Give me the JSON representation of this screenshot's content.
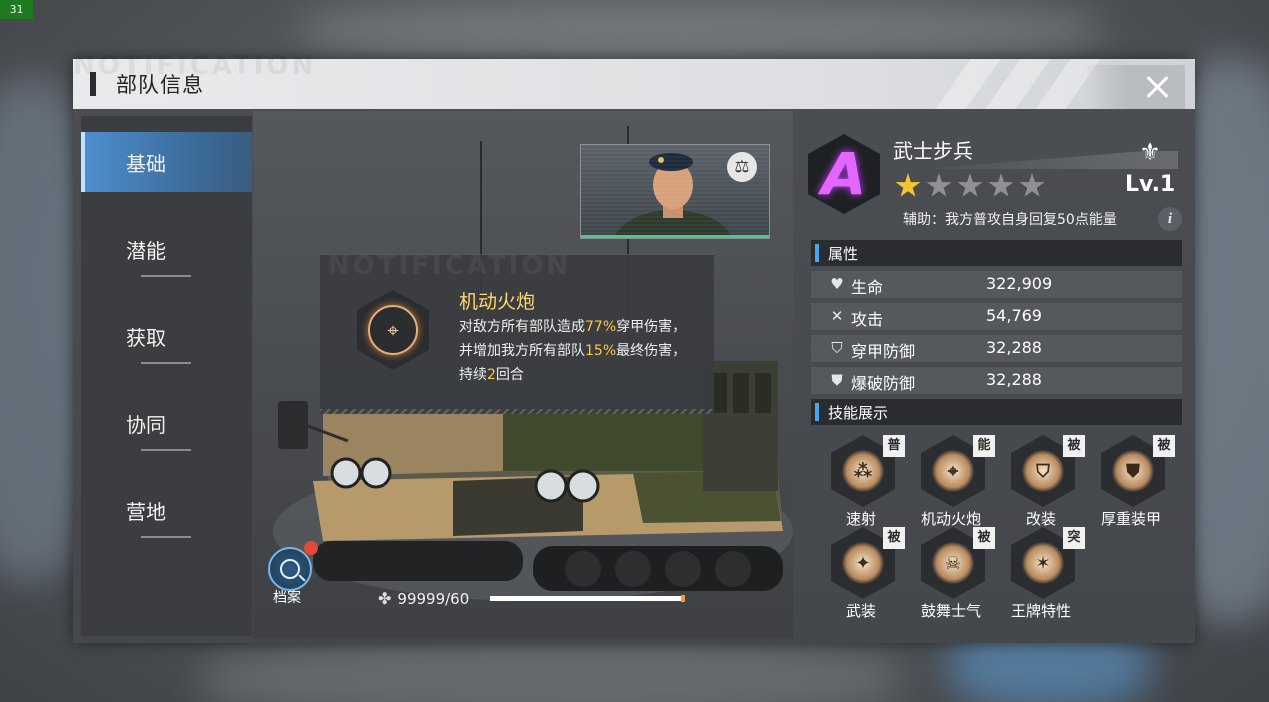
{
  "fps": "31",
  "window": {
    "title": "部队信息",
    "watermark": "NOTIFICATION"
  },
  "nav": [
    {
      "label": "基础",
      "active": true
    },
    {
      "label": "潜能",
      "active": false
    },
    {
      "label": "获取",
      "active": false
    },
    {
      "label": "协同",
      "active": false
    },
    {
      "label": "营地",
      "active": false
    }
  ],
  "popup": {
    "watermark": "NOTIFICATION",
    "skill_name": "机动火炮",
    "desc_parts": [
      "对敌方所有部队造成",
      "77%",
      "穿甲伤害，并增加我方所有部队",
      "15%",
      "最终伤害，持续",
      "2",
      "回合"
    ]
  },
  "archive_label": "档案",
  "exp": {
    "text": "99999/60",
    "progress": 1.0
  },
  "unit": {
    "rank": "A",
    "name": "武士步兵",
    "level": "Lv.1",
    "stars_filled": 1,
    "stars_total": 5,
    "assist": "辅助：我方普攻自身回复50点能量",
    "rank_color": "#e267ff",
    "star_color": "#f4c531"
  },
  "attributes": {
    "header": "属性",
    "rows": [
      {
        "icon": "heart-icon",
        "label": "生命",
        "value": "322,909"
      },
      {
        "icon": "attack-icon",
        "label": "攻击",
        "value": "54,769"
      },
      {
        "icon": "shield-pierce-icon",
        "label": "穿甲防御",
        "value": "32,288"
      },
      {
        "icon": "shield-blast-icon",
        "label": "爆破防御",
        "value": "32,288"
      }
    ]
  },
  "skills": {
    "header": "技能展示",
    "items": [
      {
        "label": "速射",
        "tag": "普",
        "icon": "rapid-fire-icon"
      },
      {
        "label": "机动火炮",
        "tag": "能",
        "icon": "mobile-artillery-icon"
      },
      {
        "label": "改装",
        "tag": "被",
        "icon": "modify-shield-icon"
      },
      {
        "label": "厚重装甲",
        "tag": "被",
        "icon": "heavy-armor-icon"
      },
      {
        "label": "武装",
        "tag": "被",
        "icon": "armed-icon"
      },
      {
        "label": "鼓舞士气",
        "tag": "被",
        "icon": "morale-icon"
      },
      {
        "label": "王牌特性",
        "tag": "突",
        "icon": "ace-trait-icon"
      }
    ]
  },
  "accent": "#4aa6f2"
}
